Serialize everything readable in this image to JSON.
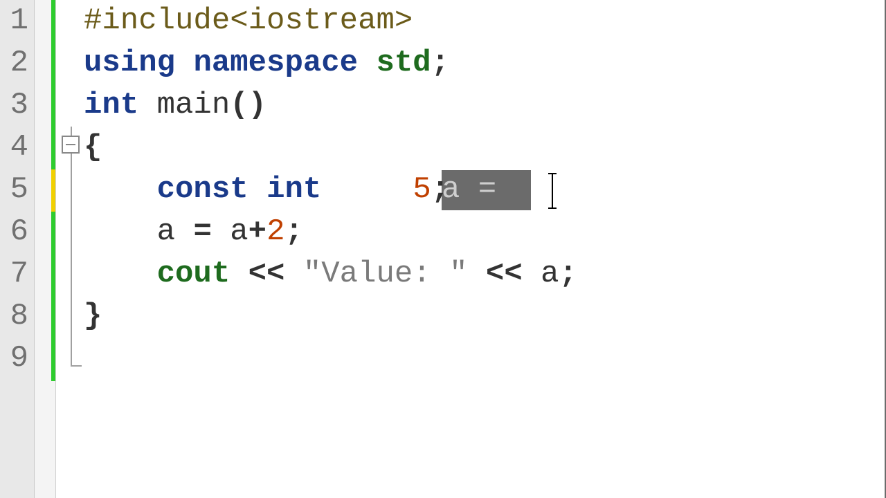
{
  "gutter": {
    "lines": [
      "1",
      "2",
      "3",
      "4",
      "5",
      "6",
      "7",
      "8",
      "9"
    ]
  },
  "code": {
    "l1": {
      "pre": "#include<iostream>"
    },
    "l2": {
      "kw_using": "using",
      "sp1": " ",
      "kw_ns": "namespace",
      "sp2": " ",
      "std": "std",
      "semi": ";"
    },
    "l3": {
      "kw_int": "int",
      "sp1": " ",
      "fn": "main",
      "parens": "()"
    },
    "l4": {
      "brace": "{"
    },
    "l5": {
      "indent": "    ",
      "kw_const": "const",
      "sp1": " ",
      "kw_int": "int",
      "sp2": " ",
      "sel_text": "a = ",
      "val": "5",
      "semi": ";"
    },
    "l6": {
      "indent": "    ",
      "lhs": "a",
      "sp1": " ",
      "eq": "=",
      "sp2": " ",
      "rhs1": "a",
      "plus": "+",
      "rhs2": "2",
      "semi": ";"
    },
    "l7": {
      "indent": "    ",
      "cout": "cout",
      "sp1": " ",
      "op1": "<<",
      "sp2": " ",
      "str": "\"Value: \"",
      "sp3": " ",
      "op2": "<<",
      "sp4": " ",
      "var": "a",
      "semi": ";"
    },
    "l8": {
      "brace": "}"
    }
  },
  "fold": {
    "icon": "collapse-icon"
  }
}
